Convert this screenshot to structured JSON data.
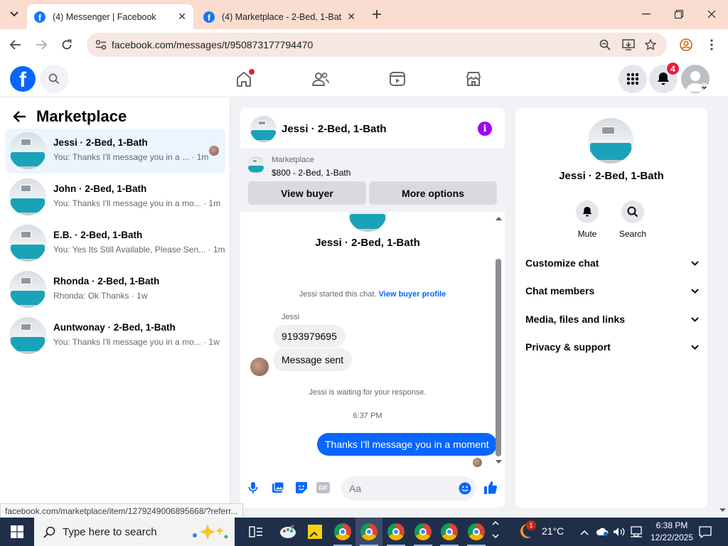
{
  "browser": {
    "tabs": [
      {
        "title": "(4) Messenger | Facebook",
        "active": true
      },
      {
        "title": "(4) Marketplace - 2-Bed, 1-Bath",
        "active": false
      }
    ],
    "url": "facebook.com/messages/t/950873177794470",
    "status_url": "facebook.com/marketplace/item/1279249006895668/?referr..."
  },
  "fb_header": {
    "notification_count": "4"
  },
  "left_panel": {
    "title": "Marketplace",
    "conversations": [
      {
        "name": "Jessi · 2-Bed, 1-Bath",
        "preview": "You: Thanks I'll message you in a ... · 1m",
        "selected": true
      },
      {
        "name": "John · 2-Bed, 1-Bath",
        "preview": "You: Thanks I'll message you in a mo... · 1m",
        "selected": false
      },
      {
        "name": "E.B. · 2-Bed, 1-Bath",
        "preview": "You: Yes Its Still Available, Please Sen... · 1m",
        "selected": false
      },
      {
        "name": "Rhonda · 2-Bed, 1-Bath",
        "preview": "Rhonda: Ok Thanks · 1w",
        "selected": false
      },
      {
        "name": "Auntwonay · 2-Bed, 1-Bath",
        "preview": "You: Thanks I'll message you in a mo... · 1w",
        "selected": false
      }
    ]
  },
  "chat": {
    "header_name": "Jessi · 2-Bed, 1-Bath",
    "listing_category": "Marketplace",
    "listing_price": "$800 - 2-Bed, 1-Bath",
    "view_buyer_label": "View buyer",
    "more_options_label": "More options",
    "profile_name": "Jessi · 2-Bed, 1-Bath",
    "started_text": "Jessi started this chat.",
    "view_buyer_profile": "View buyer profile",
    "sender_label": "Jessi",
    "message_1": "9193979695",
    "message_2": "Message sent",
    "waiting_text": "Jessi is waiting for your response.",
    "timestamp": "6:37 PM",
    "my_message": "Thanks I'll message you in a moment",
    "input_placeholder": "Aa"
  },
  "right_panel": {
    "name": "Jessi · 2-Bed, 1-Bath",
    "mute_label": "Mute",
    "search_label": "Search",
    "sections": [
      "Customize chat",
      "Chat members",
      "Media, files and links",
      "Privacy & support"
    ]
  },
  "taskbar": {
    "search_placeholder": "Type here to search",
    "temperature": "21°C",
    "time": "6:38 PM",
    "date": "12/22/2025",
    "weather_badge": "1"
  },
  "colors": {
    "fb_blue": "#0866ff",
    "messenger_purple": "#a100f2",
    "notification_red": "#e41e3f",
    "tab_strip": "#fbdcd0"
  }
}
